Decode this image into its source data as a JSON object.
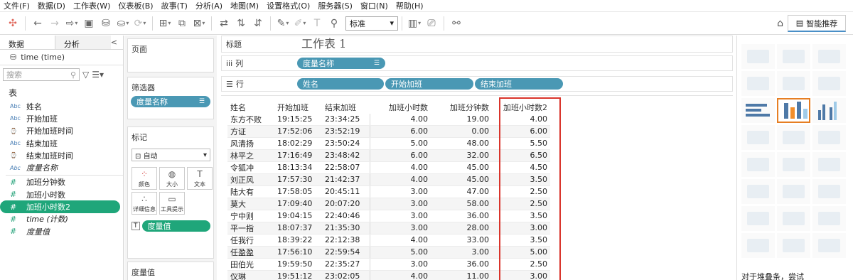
{
  "menu": [
    "文件(F)",
    "数据(D)",
    "工作表(W)",
    "仪表板(B)",
    "故事(T)",
    "分析(A)",
    "地图(M)",
    "设置格式(O)",
    "服务器(S)",
    "窗口(N)",
    "帮助(H)"
  ],
  "toolbar": {
    "fit": "标准",
    "smart": "智能推荐"
  },
  "data_pane": {
    "tab_data": "数据",
    "tab_analysis": "分析",
    "collapse": "<",
    "source": "time (time)",
    "search_placeholder": "搜索",
    "section_table": "表",
    "dimensions": [
      {
        "type": "Abc",
        "name": "姓名"
      },
      {
        "type": "Abc",
        "name": "开始加班"
      },
      {
        "type": "⌚",
        "name": "开始加班时间"
      },
      {
        "type": "Abc",
        "name": "结束加班"
      },
      {
        "type": "⌚",
        "name": "结束加班时间"
      },
      {
        "type": "Abc",
        "name": "度量名称"
      }
    ],
    "measures": [
      {
        "name": "加班分钟数"
      },
      {
        "name": "加班小时数"
      },
      {
        "name": "加班小时数2"
      },
      {
        "name": "time (计数)"
      },
      {
        "name": "度量值"
      }
    ]
  },
  "shelves": {
    "pages": "页面",
    "filters": "筛选器",
    "filter_pill": "度量名称",
    "marks": "标记",
    "mark_type": "自动",
    "mark_buttons": [
      "颜色",
      "大小",
      "文本",
      "详细信息",
      "工具提示"
    ],
    "mark_pill": "度量值",
    "measure_values": "度量值"
  },
  "top": {
    "title_label": "标题",
    "sheet_name": "工作表 1",
    "cols_label": "列",
    "cols_pills": [
      "度量名称"
    ],
    "rows_label": "行",
    "rows_pills": [
      "姓名",
      "开始加班",
      "结束加班"
    ]
  },
  "table": {
    "headers": [
      "姓名",
      "开始加班",
      "结束加班",
      "加班小时数",
      "加班分钟数",
      "加班小时数2"
    ],
    "rows": [
      [
        "东方不败",
        "19:15:25",
        "23:34:25",
        "4.00",
        "19.00",
        "4.00"
      ],
      [
        "方证",
        "17:52:06",
        "23:52:19",
        "6.00",
        "0.00",
        "6.00"
      ],
      [
        "风清扬",
        "18:02:29",
        "23:50:24",
        "5.00",
        "48.00",
        "5.50"
      ],
      [
        "林平之",
        "17:16:49",
        "23:48:42",
        "6.00",
        "32.00",
        "6.50"
      ],
      [
        "令狐冲",
        "18:13:34",
        "22:58:07",
        "4.00",
        "45.00",
        "4.50"
      ],
      [
        "刘正风",
        "17:57:30",
        "21:42:37",
        "4.00",
        "45.00",
        "3.50"
      ],
      [
        "陆大有",
        "17:58:05",
        "20:45:11",
        "3.00",
        "47.00",
        "2.50"
      ],
      [
        "莫大",
        "17:09:40",
        "20:07:20",
        "3.00",
        "58.00",
        "2.50"
      ],
      [
        "宁中则",
        "19:04:15",
        "22:40:46",
        "3.00",
        "36.00",
        "3.50"
      ],
      [
        "平一指",
        "18:07:37",
        "21:35:30",
        "3.00",
        "28.00",
        "3.00"
      ],
      [
        "任我行",
        "18:39:22",
        "22:12:38",
        "4.00",
        "33.00",
        "3.50"
      ],
      [
        "任盈盈",
        "17:56:10",
        "22:59:54",
        "5.00",
        "3.00",
        "5.00"
      ],
      [
        "田伯光",
        "19:59:50",
        "22:35:27",
        "3.00",
        "36.00",
        "2.50"
      ],
      [
        "仪琳",
        "19:51:12",
        "23:02:05",
        "4.00",
        "11.00",
        "3.00"
      ]
    ]
  },
  "showme": {
    "hint": "对于堆叠条，尝试"
  },
  "colors": {
    "pill_blue": "#4a98b4",
    "pill_green": "#1fa67a",
    "highlight": "#d9342b"
  }
}
